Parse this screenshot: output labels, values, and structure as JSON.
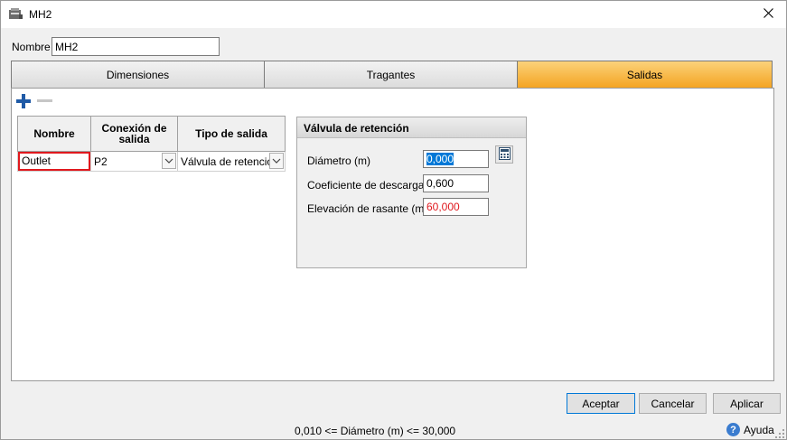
{
  "window": {
    "title": "MH2",
    "app_icon": "manhole-icon",
    "close_icon": "close-icon"
  },
  "name_field": {
    "label": "Nombre",
    "value": "MH2"
  },
  "tabs": [
    {
      "label": "Dimensiones",
      "active": false
    },
    {
      "label": "Tragantes",
      "active": false
    },
    {
      "label": "Salidas",
      "active": true
    }
  ],
  "toolbar": {
    "add_icon": "plus-icon",
    "remove_icon": "minus-icon"
  },
  "outlets_table": {
    "columns": [
      "Nombre",
      "Conexión de salida",
      "Tipo de salida"
    ],
    "rows": [
      {
        "name": "Outlet",
        "connection": "P2",
        "type": "Válvula de retención"
      }
    ]
  },
  "valve_group": {
    "title": "Válvula de retención",
    "fields": [
      {
        "label": "Diámetro (m)",
        "value": "0,000"
      },
      {
        "label": "Coeficiente de descarga",
        "value": "0,600"
      },
      {
        "label": "Elevación de rasante (m)",
        "value": "60,000"
      }
    ],
    "calculator_icon": "calculator-icon"
  },
  "buttons": {
    "accept": "Aceptar",
    "cancel": "Cancelar",
    "apply": "Aplicar"
  },
  "status": {
    "validation_message": "0,010 <= Diámetro (m) <= 30,000",
    "help_label": "Ayuda",
    "help_icon": "help-icon"
  },
  "colors": {
    "active_tab": "#f4a422",
    "error_border": "#e0191e",
    "warning_text": "#e0191e",
    "selection": "#0078d7"
  }
}
